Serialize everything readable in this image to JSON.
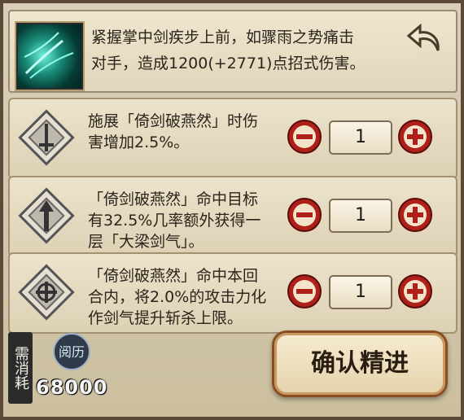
{
  "skill": {
    "description_line1": "紧握掌中剑疾步上前，如骤雨之势痛击",
    "description_line2": "对手，造成1200(+2771)点招式伤害。",
    "icon": "teal-sword-swirl-icon"
  },
  "back_icon": "curved-back-arrow-icon",
  "upgrades": [
    {
      "line1": "施展「倚剑破燕然」时伤",
      "line2": "害增加2.5%。",
      "line3": "",
      "count": "1",
      "emblem": "sword-emblem-icon"
    },
    {
      "line1": "「倚剑破燕然」命中目标",
      "line2": "有32.5%几率额外获得一",
      "line3": "层「大梁剑气」。",
      "count": "1",
      "emblem": "arrow-emblem-icon"
    },
    {
      "line1": "「倚剑破燕然」命中本回",
      "line2": "合内，将2.0%的攻击力化",
      "line3": "作剑气提升斩杀上限。",
      "count": "1",
      "emblem": "cross-emblem-icon"
    }
  ],
  "cost": {
    "label": "需消耗",
    "currency_name": "阅历",
    "amount": "68000"
  },
  "confirm_label": "确认精进",
  "colors": {
    "button_red": "#b0201a",
    "panel_border": "#5b4a37",
    "text": "#2b241b"
  }
}
